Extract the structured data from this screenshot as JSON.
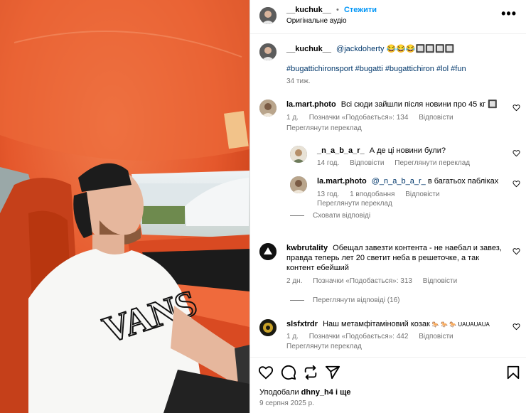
{
  "header": {
    "username": "__kuchuk__",
    "separator": "•",
    "follow_label": "Стежити",
    "audio_label": "Оригінальне аудіо",
    "more_label": "•••"
  },
  "caption": {
    "username": "__kuchuk__",
    "mention": "@jackdoherty",
    "emojis": "😂😂😂🔲🔲🔲🔲",
    "hashtags": "#bugattichironsport #bugatti #bugattichiron #lol #fun",
    "time": "34 тиж."
  },
  "comments": [
    {
      "username": "la.mart.photo",
      "text": "Всі сюди зайшли після новини про 45 кг 🔲",
      "time": "1 д.",
      "likes": "Позначки «Подобається»: 134",
      "reply": "Відповісти",
      "translate": "Переглянути переклад"
    },
    {
      "username": "_n_a_b_a_r_",
      "text": "А де ці новини були?",
      "time": "14 год.",
      "likes": "",
      "reply": "Відповісти",
      "translate": "Переглянути переклад"
    },
    {
      "username": "la.mart.photo",
      "mention": "@_n_a_b_a_r_",
      "text": "в багатьох пабліках",
      "time": "13 год.",
      "likes": "1 вподобання",
      "reply": "Відповісти",
      "translate": "Переглянути переклад"
    },
    {
      "username": "kwbrutality",
      "text_line1": "Обещал завезти контента - не наебал и завез,",
      "text_line2": "правда теперь лет 20 светит неба в решеточке, а так",
      "text_line3": "контент ебейший",
      "time": "2 дн.",
      "likes": "Позначки «Подобається»: 313",
      "reply": "Відповісти"
    },
    {
      "username": "slsfxtrdr",
      "text": "Наш метамфітаміновий козак",
      "emoji_tail": "🐎 🐎 🐎 UAUAUAUA",
      "time": "1 д.",
      "likes": "Позначки «Подобається»: 442",
      "reply": "Відповісти",
      "translate": "Переглянути переклад"
    }
  ],
  "hide_replies": "Сховати відповіді",
  "view_replies": "Переглянути відповіді (16)",
  "footer": {
    "liked_by_prefix": "Уподобали",
    "liked_by_user": "dhny_h4",
    "liked_by_suffix": "і ще",
    "date": "9 серпня 2025 р."
  },
  "icons": {
    "like": "heart-icon",
    "comment": "comment-icon",
    "share": "repost-icon",
    "send": "send-icon",
    "save": "bookmark-icon"
  },
  "colors": {
    "link": "#0095f6",
    "mention": "#00376b",
    "muted": "#737373",
    "interior_orange": "#e2512a"
  }
}
